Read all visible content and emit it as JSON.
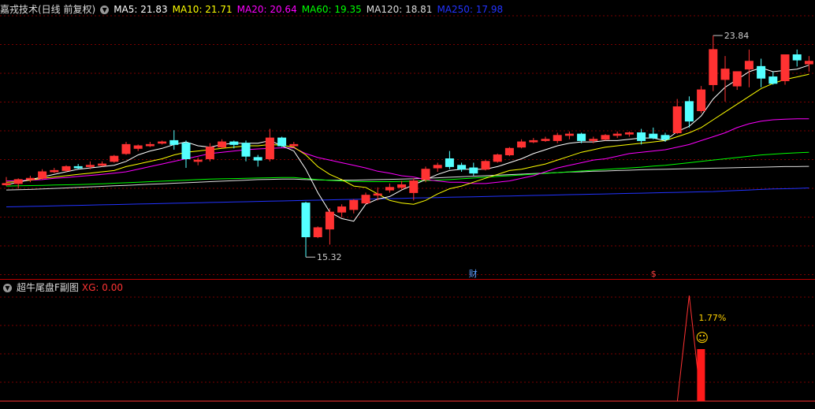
{
  "main_header": {
    "title": "嘉戎技术(日线 前复权)",
    "ma": [
      {
        "label": "MA5: 21.83",
        "color": "#ffffff"
      },
      {
        "label": "MA10: 21.71",
        "color": "#ffff00"
      },
      {
        "label": "MA20: 20.64",
        "color": "#ff00ff"
      },
      {
        "label": "MA60: 19.35",
        "color": "#00ff00"
      },
      {
        "label": "MA120: 18.81",
        "color": "#dddddd"
      },
      {
        "label": "MA250: 17.98",
        "color": "#2233ff"
      }
    ]
  },
  "sub_header": {
    "title": "超牛尾盘F副图",
    "xg_label": "XG: 0.00",
    "xg_color": "#ff3333"
  },
  "annotations": {
    "high_label": "23.84",
    "low_label": "15.32",
    "finance_marker": "财",
    "dollar_marker": "$",
    "pct_label": "1.77%",
    "smiley": "☺"
  },
  "colors": {
    "up": "#ff3232",
    "down": "#54ffff",
    "grid": "#7a0000",
    "ma5": "#ffffff",
    "ma10": "#ffff00",
    "ma20": "#ff00ff",
    "ma60": "#00ff00",
    "ma120": "#dddddd",
    "ma250": "#2233ff"
  },
  "chart_data": [
    {
      "type": "candlestick",
      "title": "嘉戎技术(日线 前复权)",
      "ylim": [
        14.6,
        24.6
      ],
      "high": 23.84,
      "low": 15.32,
      "candles": [
        [
          18.1,
          18.4,
          18.05,
          18.15
        ],
        [
          18.15,
          18.35,
          17.95,
          18.3
        ],
        [
          18.3,
          18.45,
          18.2,
          18.35
        ],
        [
          18.35,
          18.7,
          18.3,
          18.6
        ],
        [
          18.6,
          18.75,
          18.55,
          18.65
        ],
        [
          18.65,
          18.85,
          18.6,
          18.8
        ],
        [
          18.8,
          18.9,
          18.7,
          18.75
        ],
        [
          18.8,
          19.0,
          18.7,
          18.85
        ],
        [
          18.85,
          19.0,
          18.8,
          18.9
        ],
        [
          19.0,
          19.25,
          18.95,
          19.2
        ],
        [
          19.3,
          19.75,
          19.25,
          19.65
        ],
        [
          19.5,
          19.65,
          19.4,
          19.6
        ],
        [
          19.6,
          19.75,
          19.55,
          19.65
        ],
        [
          19.7,
          19.8,
          19.65,
          19.75
        ],
        [
          19.8,
          20.2,
          19.45,
          19.65
        ],
        [
          19.7,
          19.8,
          18.75,
          19.1
        ],
        [
          19.0,
          19.15,
          18.85,
          19.05
        ],
        [
          19.1,
          19.7,
          19.0,
          19.55
        ],
        [
          19.55,
          19.85,
          19.5,
          19.75
        ],
        [
          19.75,
          19.8,
          19.5,
          19.65
        ],
        [
          19.7,
          19.8,
          19.0,
          19.2
        ],
        [
          19.15,
          19.25,
          18.8,
          19.05
        ],
        [
          19.1,
          20.25,
          19.0,
          19.9
        ],
        [
          19.9,
          19.95,
          19.55,
          19.6
        ],
        [
          19.6,
          19.75,
          19.55,
          19.65
        ],
        [
          17.4,
          17.45,
          15.32,
          16.1
        ],
        [
          16.1,
          16.5,
          16.05,
          16.45
        ],
        [
          16.4,
          17.2,
          15.8,
          17.05
        ],
        [
          17.05,
          17.35,
          16.85,
          17.25
        ],
        [
          17.15,
          17.55,
          17.0,
          17.5
        ],
        [
          17.4,
          17.8,
          17.35,
          17.7
        ],
        [
          17.7,
          18.0,
          17.5,
          17.75
        ],
        [
          17.9,
          18.15,
          17.8,
          18.0
        ],
        [
          18.0,
          18.25,
          17.9,
          18.1
        ],
        [
          17.8,
          18.35,
          17.5,
          18.25
        ],
        [
          18.3,
          18.8,
          18.2,
          18.7
        ],
        [
          18.75,
          18.95,
          18.6,
          18.85
        ],
        [
          19.1,
          19.4,
          18.7,
          18.8
        ],
        [
          18.85,
          18.95,
          18.6,
          18.7
        ],
        [
          18.75,
          18.95,
          18.45,
          18.55
        ],
        [
          18.7,
          19.05,
          18.65,
          19.0
        ],
        [
          19.0,
          19.3,
          18.95,
          19.25
        ],
        [
          19.25,
          19.55,
          19.2,
          19.5
        ],
        [
          19.55,
          19.85,
          19.5,
          19.75
        ],
        [
          19.75,
          19.9,
          19.7,
          19.8
        ],
        [
          19.8,
          19.95,
          19.75,
          19.85
        ],
        [
          19.8,
          20.1,
          19.7,
          20.0
        ],
        [
          20.0,
          20.15,
          19.85,
          20.05
        ],
        [
          20.05,
          20.1,
          19.7,
          19.8
        ],
        [
          19.8,
          19.95,
          19.7,
          19.85
        ],
        [
          19.85,
          20.05,
          19.8,
          20.0
        ],
        [
          20.0,
          20.15,
          19.9,
          20.05
        ],
        [
          20.05,
          20.15,
          19.95,
          20.1
        ],
        [
          20.1,
          20.25,
          19.65,
          19.8
        ],
        [
          20.05,
          20.3,
          19.85,
          19.9
        ],
        [
          20.0,
          20.1,
          19.75,
          19.85
        ],
        [
          20.1,
          21.4,
          20.05,
          21.1
        ],
        [
          21.3,
          21.5,
          20.3,
          20.55
        ],
        [
          20.95,
          21.9,
          20.85,
          21.75
        ],
        [
          21.95,
          23.84,
          21.7,
          23.3
        ],
        [
          22.15,
          23.05,
          21.3,
          22.55
        ],
        [
          21.9,
          22.45,
          21.75,
          22.45
        ],
        [
          22.55,
          23.3,
          21.85,
          22.85
        ],
        [
          22.65,
          22.95,
          21.85,
          22.2
        ],
        [
          22.25,
          22.45,
          21.95,
          22.0
        ],
        [
          22.1,
          23.1,
          21.95,
          23.1
        ],
        [
          23.1,
          23.3,
          22.65,
          22.9
        ],
        [
          22.75,
          23.05,
          22.45,
          22.85
        ]
      ],
      "ma5": [
        18.1,
        18.2,
        18.3,
        18.4,
        18.5,
        18.6,
        18.7,
        18.75,
        18.8,
        18.85,
        19.0,
        19.25,
        19.4,
        19.5,
        19.65,
        19.75,
        19.6,
        19.55,
        19.65,
        19.7,
        19.7,
        19.7,
        19.8,
        19.6,
        19.4,
        18.7,
        17.8,
        17.05,
        16.8,
        16.7,
        17.35,
        17.55,
        17.65,
        17.9,
        18.1,
        18.3,
        18.5,
        18.65,
        18.7,
        18.7,
        18.7,
        18.8,
        18.95,
        19.1,
        19.3,
        19.45,
        19.6,
        19.7,
        19.75,
        19.75,
        19.8,
        19.8,
        19.85,
        19.9,
        19.9,
        19.8,
        20.15,
        20.35,
        20.75,
        21.4,
        21.85,
        22.15,
        22.45,
        22.6,
        22.45,
        22.5,
        22.55,
        22.7
      ],
      "ma10": [
        18.2,
        18.22,
        18.28,
        18.35,
        18.4,
        18.45,
        18.5,
        18.55,
        18.6,
        18.65,
        18.8,
        18.9,
        19.0,
        19.1,
        19.25,
        19.35,
        19.4,
        19.45,
        19.5,
        19.55,
        19.6,
        19.6,
        19.65,
        19.62,
        19.55,
        19.25,
        18.8,
        18.5,
        18.3,
        18.05,
        18.0,
        17.75,
        17.5,
        17.4,
        17.35,
        17.5,
        17.75,
        17.95,
        18.05,
        18.2,
        18.35,
        18.5,
        18.65,
        18.7,
        18.8,
        18.9,
        19.05,
        19.2,
        19.35,
        19.45,
        19.55,
        19.6,
        19.65,
        19.7,
        19.75,
        19.8,
        19.95,
        20.1,
        20.3,
        20.6,
        20.9,
        21.2,
        21.5,
        21.8,
        22.0,
        22.15,
        22.25,
        22.35
      ],
      "ma20": [
        18.25,
        18.26,
        18.28,
        18.3,
        18.35,
        18.38,
        18.42,
        18.46,
        18.5,
        18.55,
        18.6,
        18.7,
        18.8,
        18.9,
        19.0,
        19.1,
        19.2,
        19.3,
        19.35,
        19.4,
        19.45,
        19.48,
        19.5,
        19.52,
        19.52,
        19.3,
        19.15,
        19.05,
        18.95,
        18.85,
        18.75,
        18.62,
        18.55,
        18.45,
        18.4,
        18.3,
        18.25,
        18.2,
        18.2,
        18.15,
        18.15,
        18.2,
        18.25,
        18.35,
        18.45,
        18.6,
        18.75,
        18.85,
        18.95,
        19.05,
        19.1,
        19.2,
        19.3,
        19.35,
        19.4,
        19.45,
        19.55,
        19.65,
        19.8,
        19.95,
        20.1,
        20.3,
        20.45,
        20.55,
        20.6,
        20.62,
        20.64,
        20.64
      ],
      "ma60": [
        18.05,
        18.06,
        18.07,
        18.08,
        18.09,
        18.1,
        18.11,
        18.12,
        18.14,
        18.16,
        18.18,
        18.2,
        18.22,
        18.24,
        18.26,
        18.28,
        18.3,
        18.32,
        18.33,
        18.34,
        18.35,
        18.36,
        18.37,
        18.38,
        18.38,
        18.34,
        18.3,
        18.27,
        18.25,
        18.23,
        18.22,
        18.22,
        18.22,
        18.23,
        18.24,
        18.26,
        18.28,
        18.3,
        18.33,
        18.36,
        18.39,
        18.42,
        18.45,
        18.48,
        18.51,
        18.54,
        18.57,
        18.6,
        18.63,
        18.66,
        18.69,
        18.72,
        18.75,
        18.78,
        18.82,
        18.85,
        18.9,
        18.95,
        19.0,
        19.05,
        19.1,
        19.15,
        19.2,
        19.25,
        19.28,
        19.31,
        19.33,
        19.35
      ],
      "ma120": [
        17.9,
        17.91,
        17.92,
        17.94,
        17.96,
        17.98,
        18.0,
        18.02,
        18.04,
        18.06,
        18.08,
        18.1,
        18.12,
        18.14,
        18.16,
        18.18,
        18.2,
        18.22,
        18.24,
        18.26,
        18.28,
        18.3,
        18.31,
        18.32,
        18.32,
        18.3,
        18.29,
        18.28,
        18.28,
        18.28,
        18.29,
        18.3,
        18.31,
        18.32,
        18.33,
        18.35,
        18.37,
        18.39,
        18.41,
        18.43,
        18.45,
        18.47,
        18.49,
        18.51,
        18.53,
        18.55,
        18.57,
        18.59,
        18.6,
        18.62,
        18.63,
        18.65,
        18.66,
        18.68,
        18.69,
        18.7,
        18.71,
        18.72,
        18.73,
        18.74,
        18.75,
        18.76,
        18.77,
        18.78,
        18.79,
        18.8,
        18.8,
        18.81
      ],
      "ma250": [
        17.25,
        17.26,
        17.27,
        17.28,
        17.29,
        17.3,
        17.31,
        17.32,
        17.33,
        17.34,
        17.35,
        17.36,
        17.37,
        17.38,
        17.39,
        17.4,
        17.41,
        17.42,
        17.43,
        17.44,
        17.45,
        17.46,
        17.47,
        17.48,
        17.49,
        17.5,
        17.51,
        17.52,
        17.53,
        17.54,
        17.55,
        17.56,
        17.57,
        17.58,
        17.59,
        17.6,
        17.61,
        17.62,
        17.63,
        17.64,
        17.65,
        17.66,
        17.67,
        17.68,
        17.69,
        17.7,
        17.71,
        17.72,
        17.73,
        17.74,
        17.75,
        17.76,
        17.77,
        17.78,
        17.79,
        17.8,
        17.81,
        17.82,
        17.83,
        17.84,
        17.86,
        17.88,
        17.9,
        17.92,
        17.94,
        17.95,
        17.96,
        17.98
      ]
    },
    {
      "type": "bar",
      "title": "超牛尾盘F副图",
      "series": [
        {
          "name": "XG",
          "values": [
            0
          ]
        }
      ],
      "ylim": [
        0,
        1.77
      ],
      "signal_index": 57,
      "signal_value": 1.77
    }
  ]
}
